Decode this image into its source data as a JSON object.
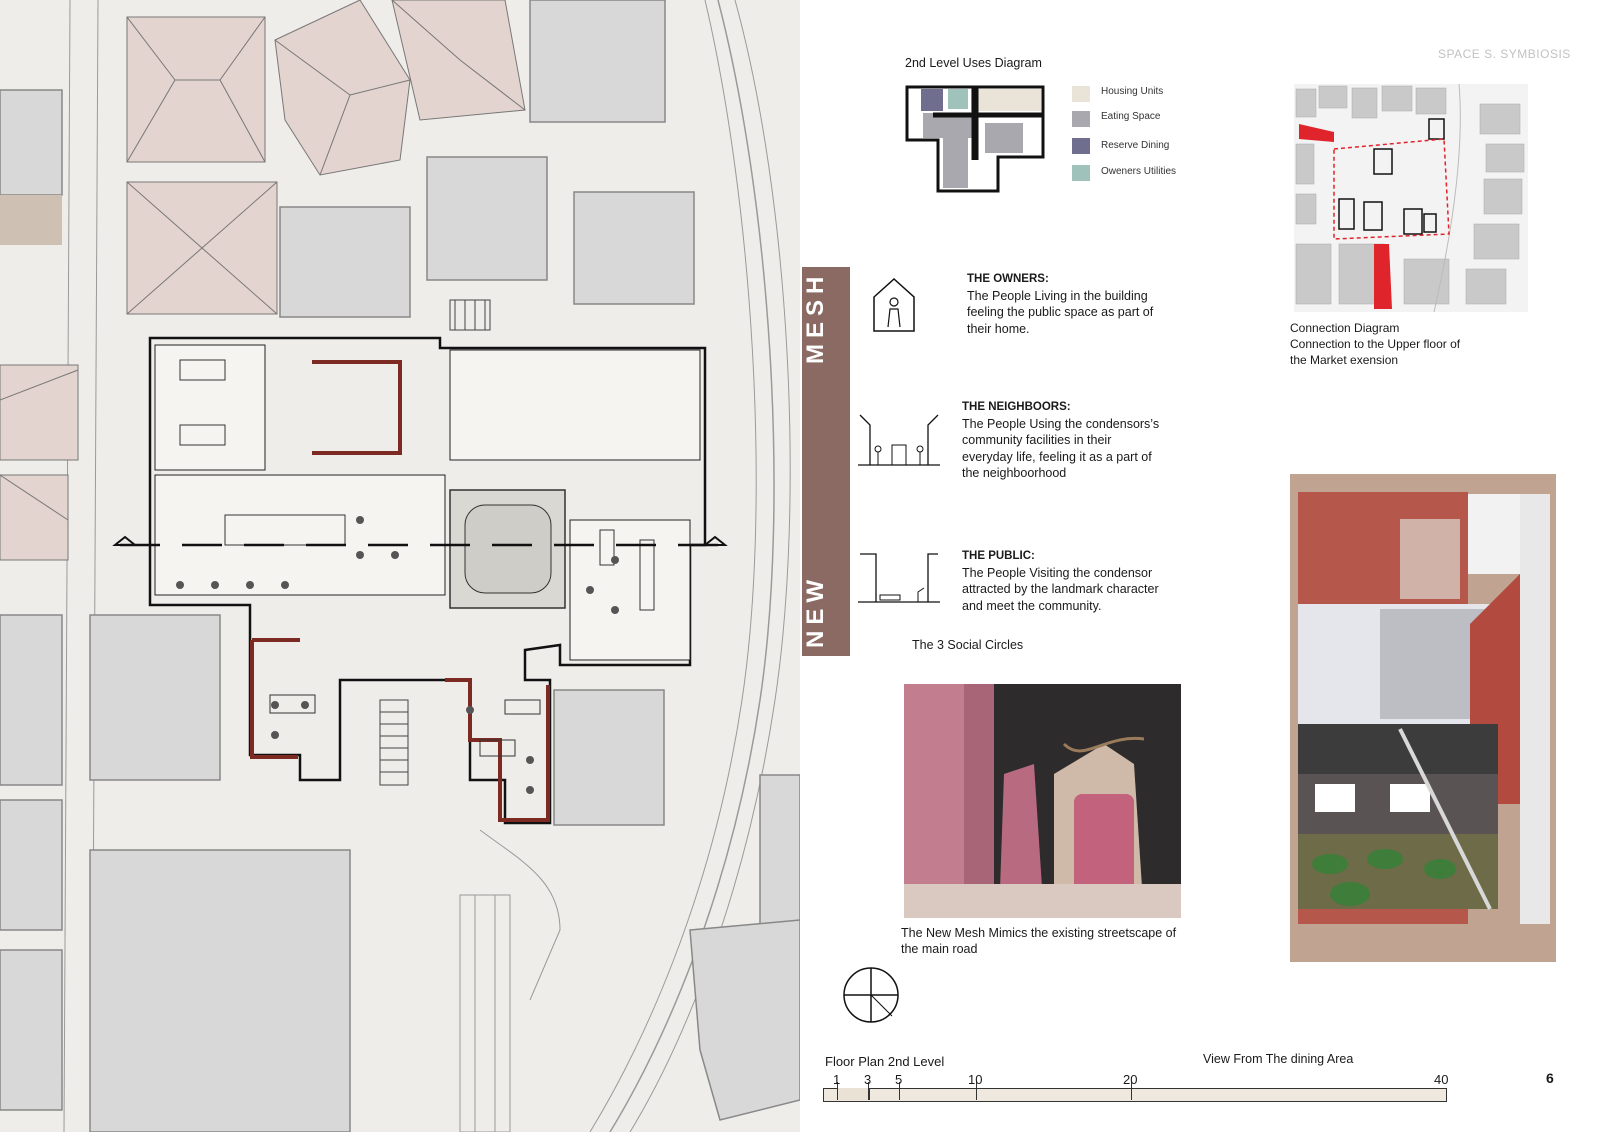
{
  "header": {
    "title": "SPACE S. SYMBIOSIS",
    "page_number": "6"
  },
  "uses_diagram": {
    "title": "2nd Level Uses Diagram",
    "legend": [
      {
        "label": "Housing Units",
        "color": "#e9e3d8"
      },
      {
        "label": "Eating Space",
        "color": "#a9a8ae"
      },
      {
        "label": "Reserve Dining",
        "color": "#6f6e8e"
      },
      {
        "label": "Oweners Utilities",
        "color": "#9fc2bb"
      }
    ]
  },
  "connection_diagram": {
    "title": "Connection Diagram",
    "caption": "Connection to the Upper floor of the Market exension"
  },
  "mesh_bar": {
    "top_word": "MESH",
    "bottom_word": "NEW"
  },
  "social_circles": {
    "title": "The 3 Social Circles",
    "owners": {
      "heading": "THE OWNERS:",
      "text": "The People Living in the building feeling the public space as part of their home."
    },
    "neighbors": {
      "heading": "THE NEIGHBOORS:",
      "text": "The People Using the condensors’s community facilities in their everyday life, feeling it as a part of the neighboorhood"
    },
    "public": {
      "heading": "THE PUBLIC:",
      "text": "The People Visiting the condensor attracted by the landmark character and meet the community."
    }
  },
  "model_photo": {
    "caption": "The New Mesh Mimics the existing streetscape of the main road"
  },
  "floor_plan": {
    "title": "Floor Plan 2nd Level"
  },
  "view_caption": "View From The dining Area",
  "scale_bar": {
    "ticks": [
      "1",
      "3",
      "5",
      "10",
      "20",
      "40"
    ]
  }
}
